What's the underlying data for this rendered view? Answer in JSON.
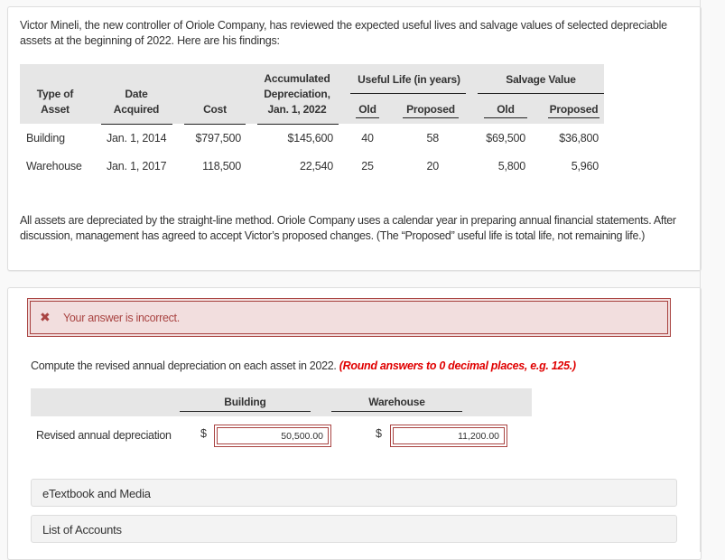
{
  "problem": {
    "intro": "Victor Mineli, the new controller of Oriole Company, has reviewed the expected useful lives and salvage values of selected depreciable assets at the beginning of 2022. Here are his findings:",
    "table": {
      "headers": {
        "type_of_asset": [
          "Type of",
          "Asset"
        ],
        "date_acquired": [
          "Date",
          "Acquired"
        ],
        "cost": "Cost",
        "accum_dep": [
          "Accumulated",
          "Depreciation,",
          "Jan. 1, 2022"
        ],
        "useful_life": "Useful Life (in years)",
        "salvage_value": "Salvage Value",
        "old": "Old",
        "proposed": "Proposed"
      },
      "rows": [
        {
          "type": "Building",
          "date": "Jan. 1, 2014",
          "cost": "$797,500",
          "accum": "$145,600",
          "life_old": "40",
          "life_proposed": "58",
          "salvage_old": "$69,500",
          "salvage_proposed": "$36,800"
        },
        {
          "type": "Warehouse",
          "date": "Jan. 1, 2017",
          "cost": "118,500",
          "accum": "22,540",
          "life_old": "25",
          "life_proposed": "20",
          "salvage_old": "5,800",
          "salvage_proposed": "5,960"
        }
      ]
    },
    "description": "All assets are depreciated by the straight-line method. Oriole Company uses a calendar year in preparing annual financial statements. After discussion, management has agreed to accept Victor’s proposed changes. (The “Proposed” useful life is total life, not remaining life.)"
  },
  "answer": {
    "alert_icon": "x-mark-icon",
    "alert_message": "Your answer is incorrect.",
    "instruction": "Compute the revised annual depreciation on each asset in 2022.",
    "hint": "(Round answers to 0 decimal places, e.g. 125.)",
    "columns": [
      "Building",
      "Warehouse"
    ],
    "row_label": "Revised annual depreciation",
    "currency": "$",
    "values": [
      "50,500.00",
      "11,200.00"
    ]
  },
  "accordions": [
    "eTextbook and Media",
    "List of Accounts"
  ],
  "colors": {
    "error": "#a94442",
    "error_bg": "#f2dede",
    "hint": "#e00000",
    "header_bg": "#e6e6e6"
  }
}
